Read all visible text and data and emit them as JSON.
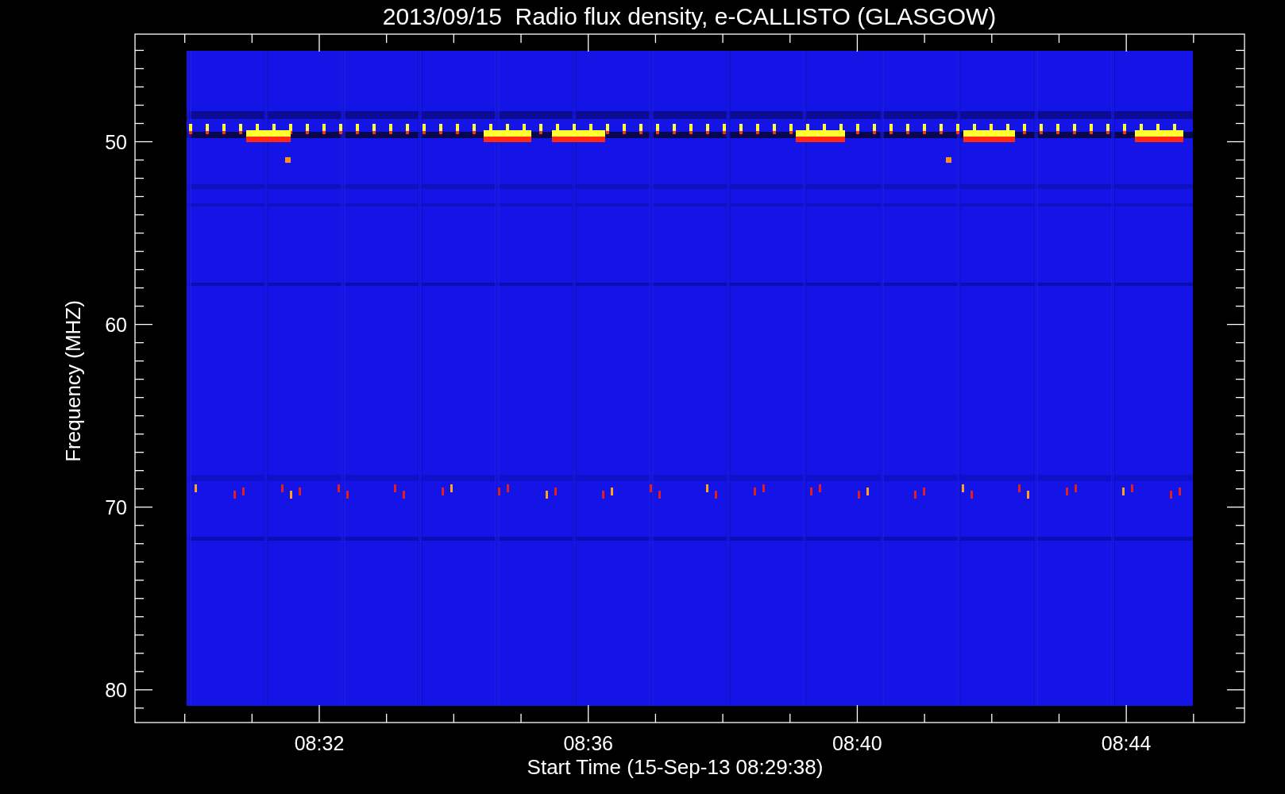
{
  "title": "2013/09/15  Radio flux density, e-CALLISTO (GLASGOW)",
  "y_axis": {
    "label": "Frequency (MHZ)",
    "ticks": [
      "50",
      "60",
      "70",
      "80"
    ]
  },
  "x_axis": {
    "label": "Start Time (15-Sep-13 08:29:38)",
    "ticks": [
      "08:32",
      "08:36",
      "08:40",
      "08:44"
    ]
  }
}
